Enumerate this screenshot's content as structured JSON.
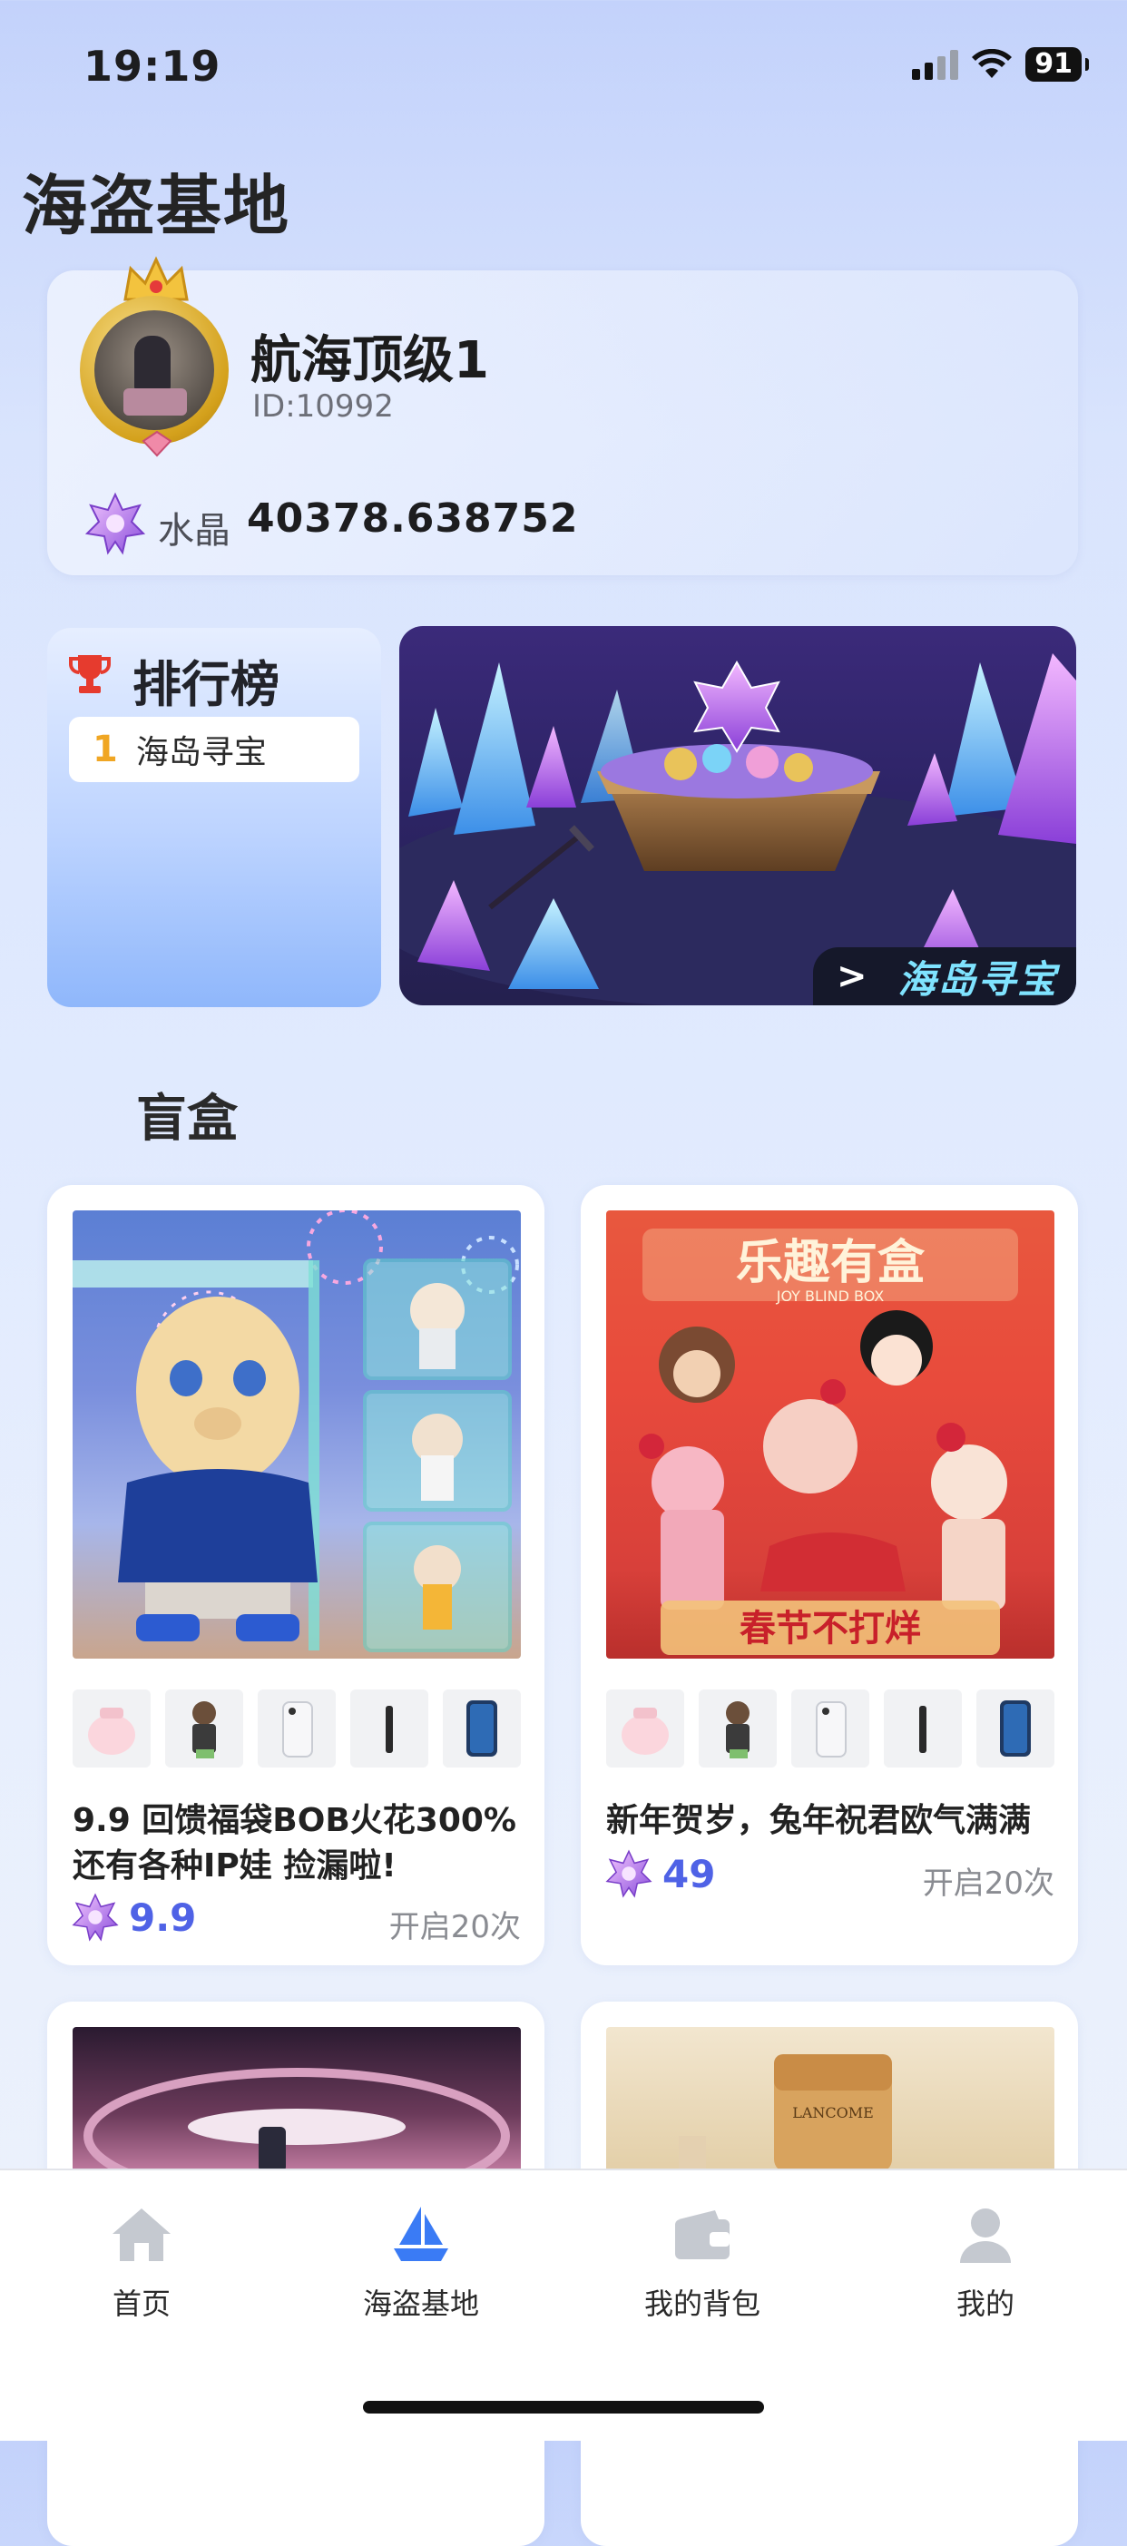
{
  "status_bar": {
    "time": "19:19",
    "battery": "91"
  },
  "page_title": "海盗基地",
  "profile": {
    "nickname": "航海顶级1",
    "id_text": "ID:10992",
    "crystal_label": "水晶",
    "crystal_value": "40378.638752"
  },
  "ranking": {
    "title": "排行榜",
    "items": [
      {
        "rank": "1",
        "name": "海岛寻宝"
      }
    ]
  },
  "banner": {
    "label": "海岛寻宝"
  },
  "section_title": "盲盒",
  "products": [
    {
      "title": "9.9 回馈福袋BOB火花300% 还有各种IP娃 捡漏啦!",
      "price": "9.9",
      "open_count": "开启20次",
      "thumbs": [
        "bag-icon",
        "figure-icon",
        "phone-white-icon",
        "stick-icon",
        "phone-dark-icon"
      ]
    },
    {
      "title": "新年贺岁，兔年祝君欧气满满",
      "price": "49",
      "open_count": "开启20次",
      "thumbs": [
        "bag-icon",
        "figure-icon",
        "phone-white-icon",
        "stick-icon",
        "phone-dark-icon"
      ]
    }
  ],
  "product_images": {
    "right_top_text": "乐趣有盒",
    "right_sub_text": "JOY BLIND BOX",
    "right_bottom_text": "春节不打烊",
    "lower_right_text": "LANCOME"
  },
  "nav": {
    "items": [
      {
        "label": "首页",
        "icon": "home-icon",
        "active": false
      },
      {
        "label": "海盗基地",
        "icon": "ship-icon",
        "active": true
      },
      {
        "label": "我的背包",
        "icon": "wallet-icon",
        "active": false
      },
      {
        "label": "我的",
        "icon": "user-icon",
        "active": false
      }
    ]
  },
  "colors": {
    "accent": "#4f62e6",
    "rank_gold": "#f0a623",
    "nav_active": "#3a7bf5",
    "nav_inactive": "#c5c9d0"
  }
}
